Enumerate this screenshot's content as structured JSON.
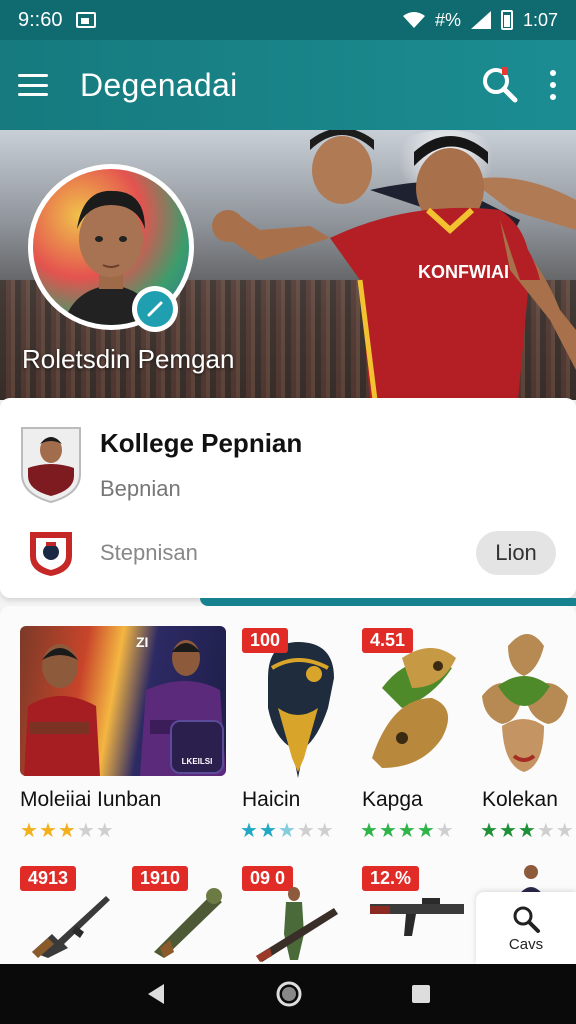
{
  "status_bar": {
    "time": "9::60",
    "right_text": "#%",
    "clock": "1:07"
  },
  "app_bar": {
    "title": "Degenadai"
  },
  "hero": {
    "name": "Roletsdin Pemgan",
    "jersey_text": "KONFWIAI"
  },
  "profile_card": {
    "title": "Kollege Pepnian",
    "subtitle": "Bepnian",
    "stat_label": "Stepnisan",
    "action_label": "Lion"
  },
  "feature": {
    "corner_tag": "ZI",
    "logo_text": "LKEILSI"
  },
  "items": [
    {
      "name": "Moleiiai Iunban",
      "price": "",
      "rating": 3,
      "star_color": "#f2b01e"
    },
    {
      "name": "Haicin",
      "price": "100",
      "rating": 2.5,
      "star_color": "#22a8c4"
    },
    {
      "name": "Kapga",
      "price": "4.51",
      "rating": 4,
      "star_color": "#2fb44a"
    },
    {
      "name": "Kolekan",
      "price": "",
      "rating": 3,
      "star_color": "#1f8f38"
    }
  ],
  "weapons": [
    {
      "price": "4913"
    },
    {
      "price": "1910"
    },
    {
      "price": "09 0"
    },
    {
      "price": "12.%"
    }
  ],
  "float_card": {
    "label": "Cavs"
  },
  "colors": {
    "primary": "#167a7e",
    "accent": "#1f9fb0",
    "price_red": "#e12b26"
  },
  "icons": [
    "hamburger-icon",
    "search-icon",
    "more-vert-icon",
    "edit-icon",
    "back-icon",
    "home-icon",
    "recent-apps-icon"
  ]
}
